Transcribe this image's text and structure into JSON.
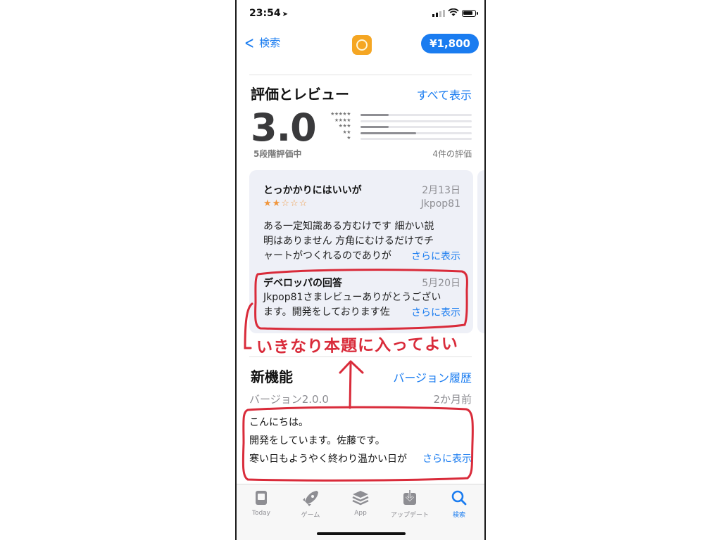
{
  "status_bar": {
    "time": "23:54"
  },
  "nav": {
    "back_label": "検索",
    "price": "¥1,800"
  },
  "ratings": {
    "title": "評価とレビュー",
    "see_all": "すべて表示",
    "score": "3.0",
    "out_of": "5段階評価中",
    "count": "4件の評価",
    "distribution": [
      {
        "stars": "★★★★★",
        "fraction": 0.25
      },
      {
        "stars": "★★★★",
        "fraction": 0.0
      },
      {
        "stars": "★★★",
        "fraction": 0.25
      },
      {
        "stars": "★★",
        "fraction": 0.5
      },
      {
        "stars": "★",
        "fraction": 0.0
      }
    ]
  },
  "review": {
    "title": "とっかかりにはいいが",
    "date": "2月13日",
    "stars_filled": "★★",
    "stars_empty": "☆☆☆",
    "user": "Jkpop81",
    "body_line1": "ある一定知識ある方むけです 細かい説",
    "body_line2": "明はありません 方角にむけるだけでチ",
    "body_line3": "ャートがつくれるのでありが",
    "more": "さらに表示",
    "developer": {
      "title": "デベロッパの回答",
      "date": "5月20日",
      "line1": "Jkpop81さまレビューありがとうござい",
      "line2": "ます。開発をしております佐",
      "more": "さらに表示"
    }
  },
  "whats_new": {
    "title": "新機能",
    "history": "バージョン履歴",
    "version": "バージョン2.0.0",
    "ago": "2か月前",
    "notes": [
      "こんにちは。",
      "開発をしています。佐藤です。",
      "寒い日もようやく終わり温かい日が"
    ],
    "more": "さらに表示"
  },
  "tabs": [
    {
      "label": "Today",
      "icon": "today-icon",
      "active": false
    },
    {
      "label": "ゲーム",
      "icon": "rocket-icon",
      "active": false
    },
    {
      "label": "App",
      "icon": "layers-icon",
      "active": false
    },
    {
      "label": "アップデート",
      "icon": "download-icon",
      "active": false
    },
    {
      "label": "検索",
      "icon": "search-icon",
      "active": true
    }
  ],
  "annotation": {
    "text": "いきなり本題に入ってよい",
    "color": "#d92b3a"
  },
  "colors": {
    "accent": "#1a7cf0",
    "star": "#f0953b",
    "card": "#eef0f7",
    "annotation": "#d92b3a"
  }
}
